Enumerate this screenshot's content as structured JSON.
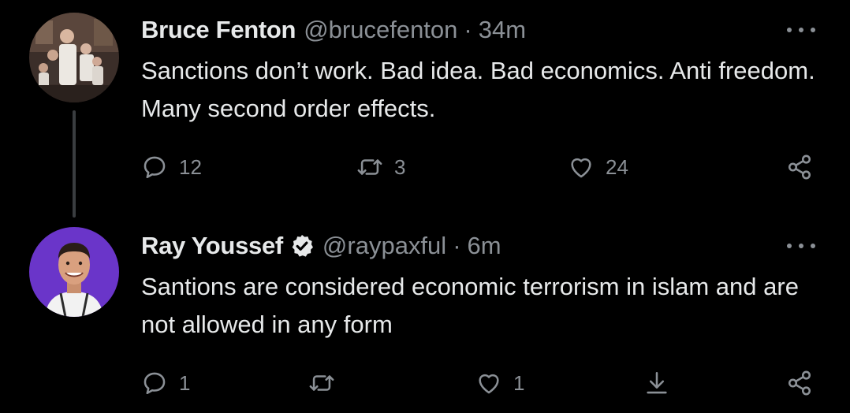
{
  "tweets": [
    {
      "display_name": "Bruce Fenton",
      "handle": "@brucefenton",
      "separator": "·",
      "time": "34m",
      "text": "Sanctions don’t work. Bad idea. Bad economics. Anti freedom. Many second order effects.",
      "verified": false,
      "reply_count": "12",
      "retweet_count": "3",
      "like_count": "24",
      "avatar_icon": "family-photo-avatar",
      "actions": [
        "reply-icon",
        "retweet-icon",
        "like-icon",
        "share-icon"
      ]
    },
    {
      "display_name": "Ray Youssef",
      "handle": "@raypaxful",
      "separator": "·",
      "time": "6m",
      "text": "Santions are considered economic terrorism in islam and are not allowed in any form",
      "verified": true,
      "reply_count": "1",
      "retweet_count": "",
      "like_count": "1",
      "avatar_icon": "portrait-avatar-purple",
      "actions": [
        "reply-icon",
        "retweet-icon",
        "like-icon",
        "download-icon",
        "share-icon"
      ]
    }
  ],
  "colors": {
    "background": "#000000",
    "primary_text": "#e7e9ea",
    "secondary_text": "#8b9096",
    "thread_line": "#3a3d40",
    "avatar_purple": "#6a35c9"
  }
}
